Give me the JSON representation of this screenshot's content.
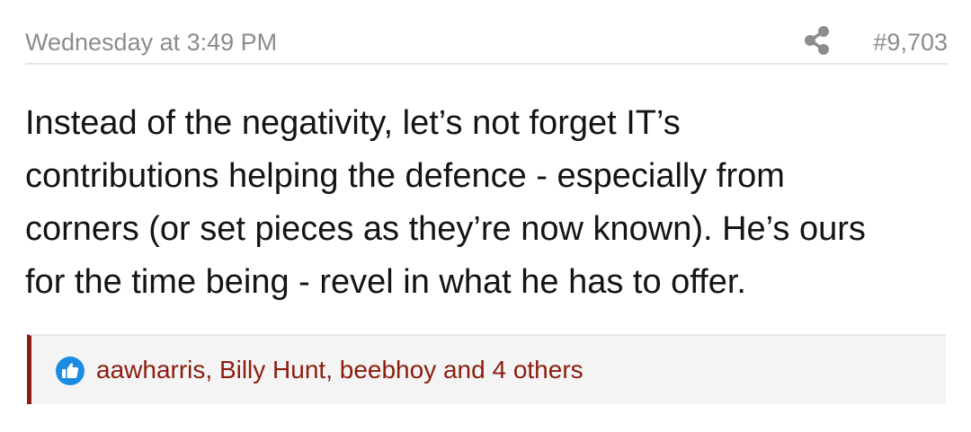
{
  "post": {
    "timestamp": "Wednesday at 3:49 PM",
    "share_icon": "share-icon",
    "post_number": "#9,703",
    "message_lines": [
      "Instead of the negativity, let’s not forget IT’s",
      "contributions helping the defence - especially from",
      "corners (or set pieces as they’re now known). He’s ours",
      "for the time being - revel in what he has to offer."
    ],
    "reactions": {
      "icon": "like-icon",
      "users_text": "aawharris, Billy Hunt, beebhoy and 4 others"
    }
  },
  "colors": {
    "meta_text": "#8c8c8c",
    "body_text": "#141414",
    "accent": "#8b1c0e",
    "reaction_bg": "#f4f4f4",
    "like_blue": "#1b8ce0"
  }
}
